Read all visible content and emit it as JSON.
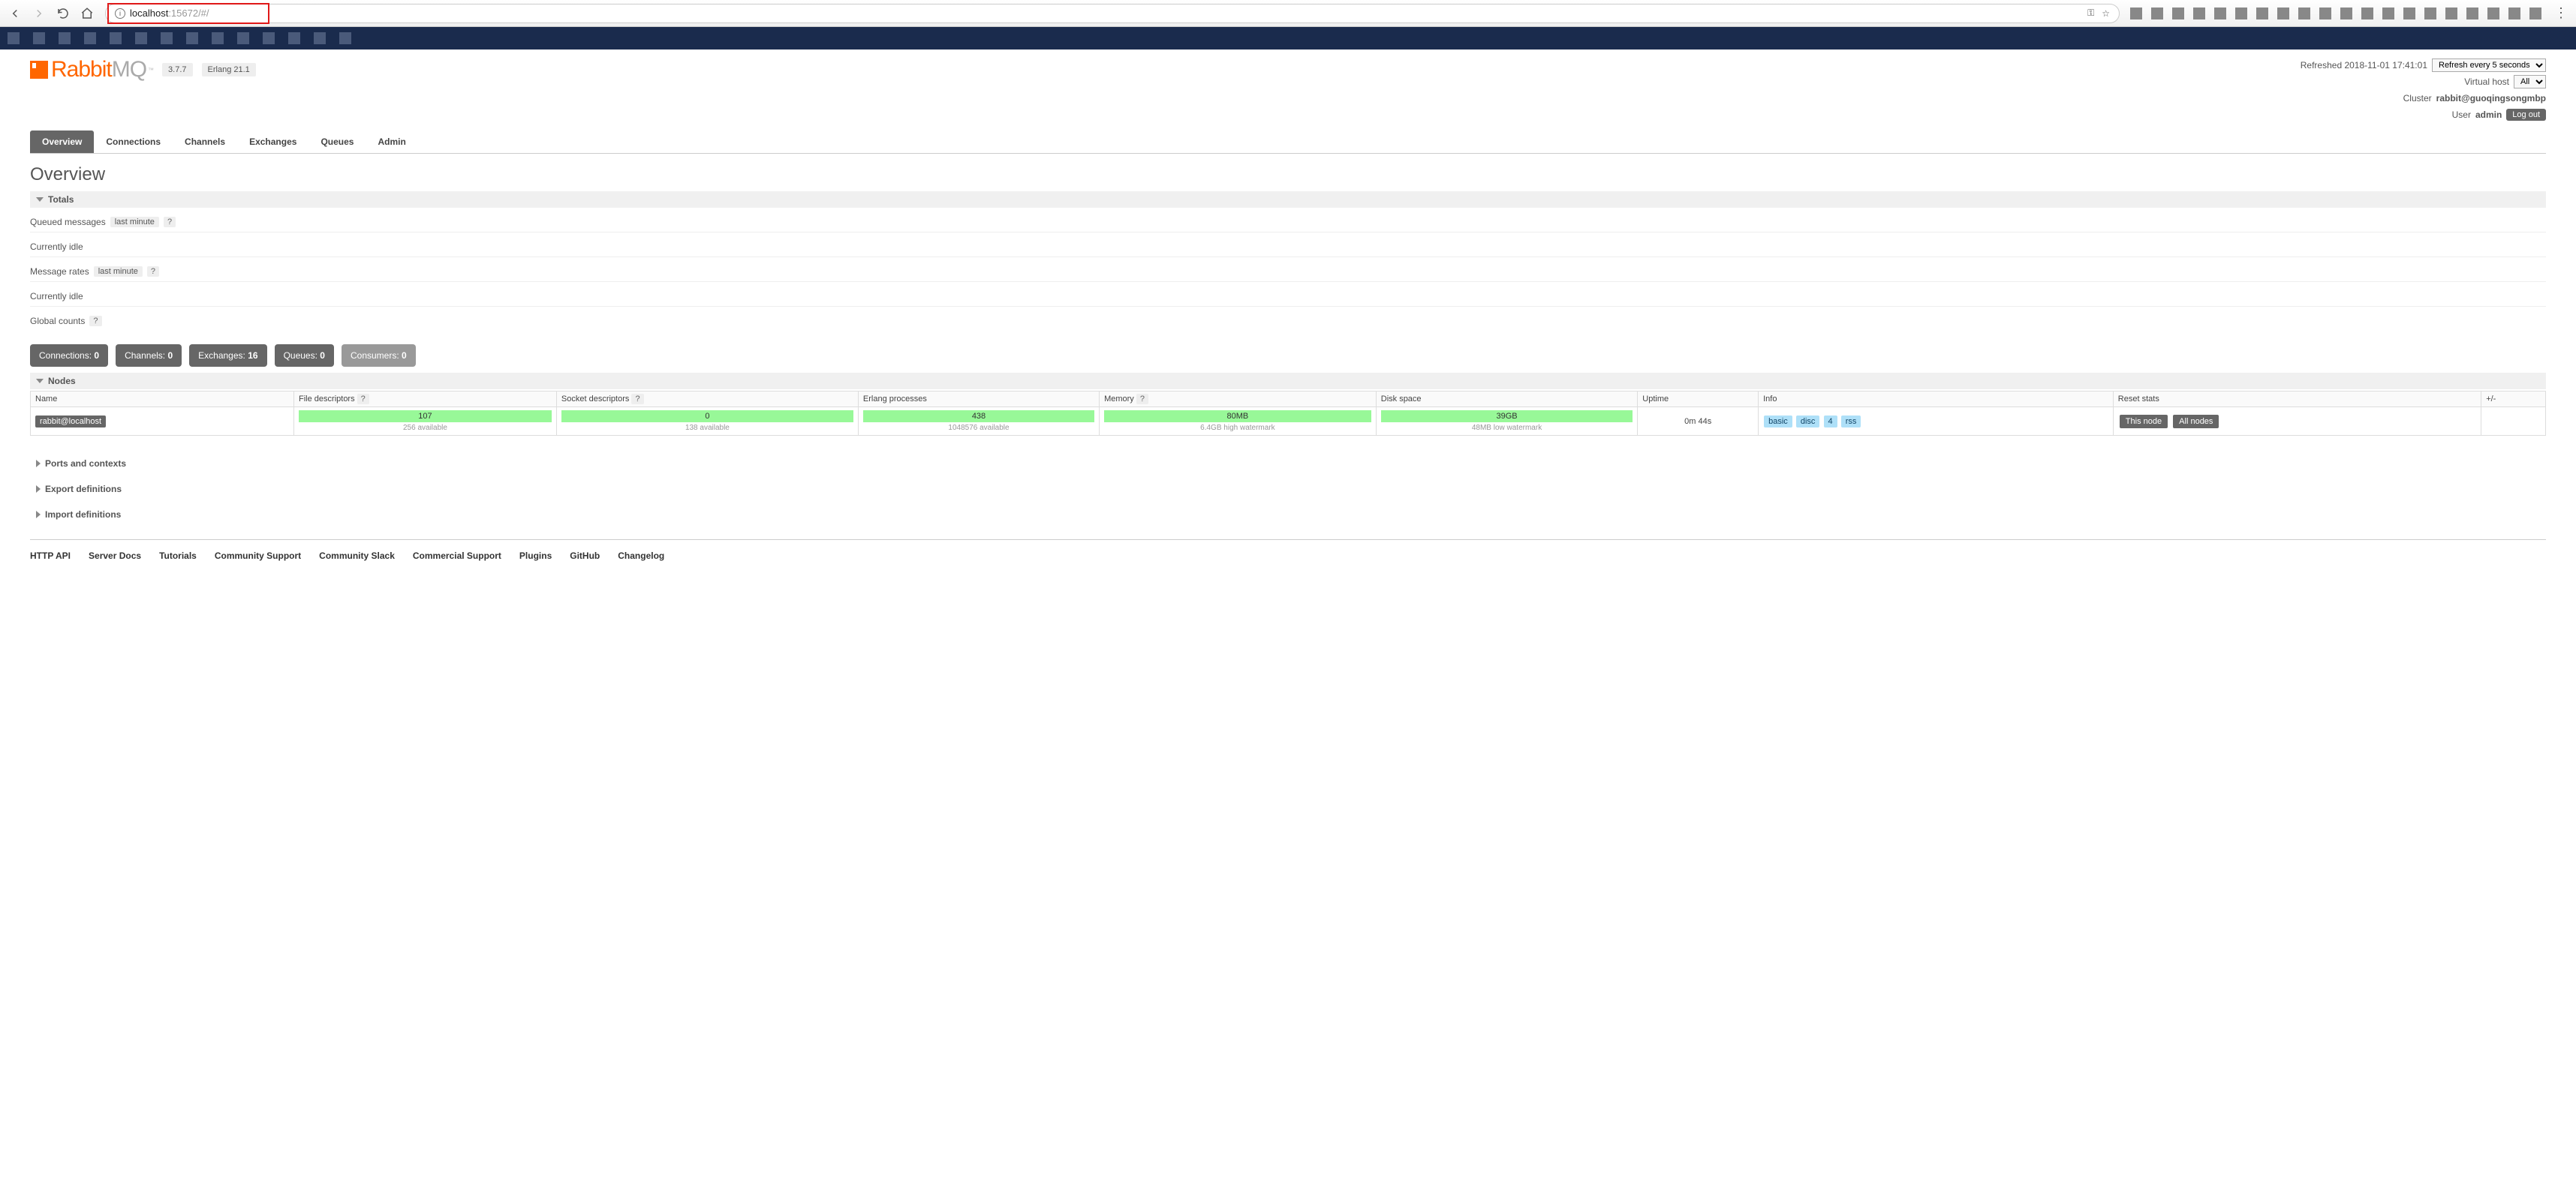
{
  "browser": {
    "url_host": "localhost",
    "url_tail": ":15672/#/",
    "info_glyph": "i",
    "key_icon": "⚿",
    "star_icon": "☆"
  },
  "logo": {
    "prefix": "Rabbit",
    "suffix": "MQ",
    "tm": "™"
  },
  "versions": {
    "rabbit": "3.7.7",
    "erlang": "Erlang 21.1"
  },
  "header": {
    "refreshed_label": "Refreshed 2018-11-01 17:41:01",
    "refresh_select": "Refresh every 5 seconds",
    "vhost_label": "Virtual host",
    "vhost_select": "All",
    "cluster_label": "Cluster",
    "cluster_name": "rabbit@guoqingsongmbp",
    "user_label": "User",
    "user_name": "admin",
    "logout": "Log out"
  },
  "tabs": [
    "Overview",
    "Connections",
    "Channels",
    "Exchanges",
    "Queues",
    "Admin"
  ],
  "page_title": "Overview",
  "sections": {
    "totals": "Totals",
    "nodes": "Nodes",
    "ports": "Ports and contexts",
    "export": "Export definitions",
    "import": "Import definitions"
  },
  "totals_block": {
    "queued_label": "Queued messages",
    "last_minute": "last minute",
    "q_help": "?",
    "idle1": "Currently idle",
    "rates_label": "Message rates",
    "idle2": "Currently idle",
    "global_label": "Global counts",
    "g_help": "?"
  },
  "counts": [
    {
      "label": "Connections:",
      "value": "0",
      "muted": false
    },
    {
      "label": "Channels:",
      "value": "0",
      "muted": false
    },
    {
      "label": "Exchanges:",
      "value": "16",
      "muted": false
    },
    {
      "label": "Queues:",
      "value": "0",
      "muted": false
    },
    {
      "label": "Consumers:",
      "value": "0",
      "muted": true
    }
  ],
  "nodes_table": {
    "headers": {
      "name": "Name",
      "fd": "File descriptors",
      "sd": "Socket descriptors",
      "ep": "Erlang processes",
      "mem": "Memory",
      "disk": "Disk space",
      "uptime": "Uptime",
      "info": "Info",
      "reset": "Reset stats",
      "pm": "+/-",
      "help": "?"
    },
    "row": {
      "name": "rabbit@localhost",
      "fd_val": "107",
      "fd_sub": "256 available",
      "sd_val": "0",
      "sd_sub": "138 available",
      "ep_val": "438",
      "ep_sub": "1048576 available",
      "mem_val": "80MB",
      "mem_sub": "6.4GB high watermark",
      "disk_val": "39GB",
      "disk_sub": "48MB low watermark",
      "uptime": "0m 44s",
      "info_badges": [
        "basic",
        "disc",
        "4",
        "rss"
      ],
      "reset_this": "This node",
      "reset_all": "All nodes"
    }
  },
  "footer": [
    "HTTP API",
    "Server Docs",
    "Tutorials",
    "Community Support",
    "Community Slack",
    "Commercial Support",
    "Plugins",
    "GitHub",
    "Changelog"
  ]
}
